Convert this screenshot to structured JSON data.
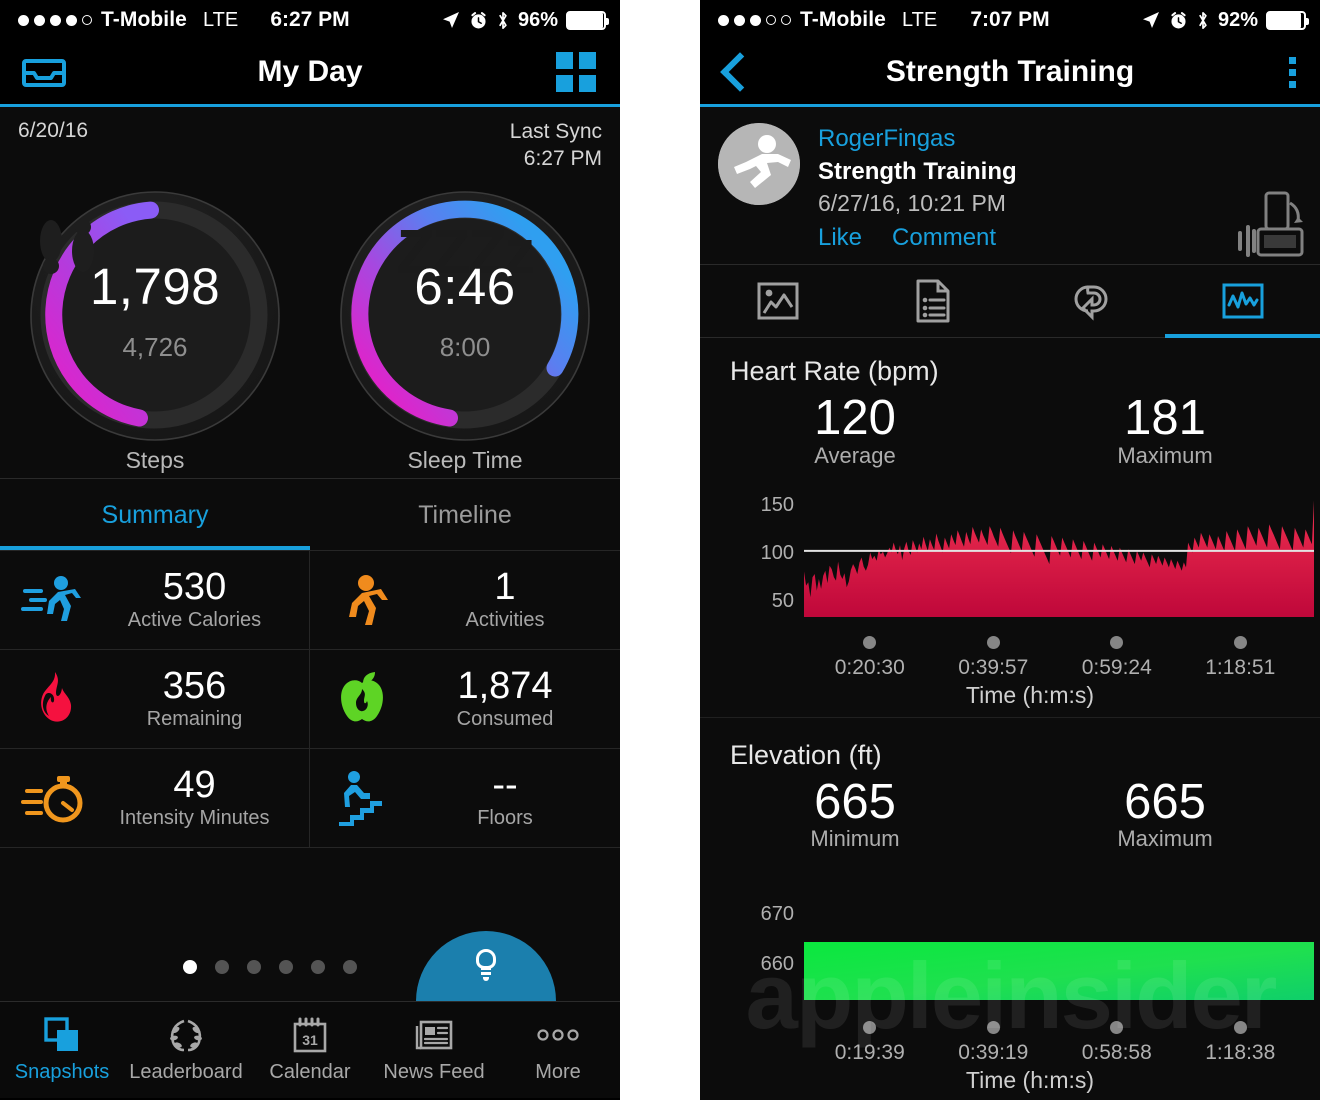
{
  "left_phone": {
    "status_bar": {
      "signal_dots_filled": 4,
      "signal_dots_total": 5,
      "carrier": "T-Mobile",
      "network": "LTE",
      "time": "6:27 PM",
      "battery_percent": "96%",
      "icons": [
        "location-arrow-icon",
        "alarm-clock-icon",
        "bluetooth-icon",
        "battery-icon"
      ]
    },
    "nav": {
      "left_icon": "inbox-icon",
      "title": "My Day",
      "right_icon": "grid-icon",
      "accent": "#18a0dd"
    },
    "header_row": {
      "date": "6/20/16",
      "sync_label": "Last Sync",
      "sync_time": "6:27 PM"
    },
    "gauges": [
      {
        "glyph": "footprints-icon",
        "value": "1,798",
        "goal": "4,726",
        "label": "Steps",
        "progress": 0.38,
        "color_start": "#8b5cf6",
        "color_end": "#e520c8"
      },
      {
        "glyph": "ZZZz",
        "value": "6:46",
        "goal": "8:00",
        "label": "Sleep Time",
        "progress": 0.845,
        "color_start": "#2f9ff0",
        "color_end": "#e520c8"
      }
    ],
    "segments": [
      {
        "label": "Summary",
        "active": true
      },
      {
        "label": "Timeline",
        "active": false
      }
    ],
    "stats": [
      {
        "icon": "running-person-icon",
        "icon_color": "#1f9fe0",
        "value": "530",
        "caption": "Active Calories"
      },
      {
        "icon": "running-person-icon",
        "icon_color": "#f08b1d",
        "value": "1",
        "caption": "Activities"
      },
      {
        "icon": "flame-icon",
        "icon_color": "#f5113f",
        "value": "356",
        "caption": "Remaining"
      },
      {
        "icon": "apple-icon",
        "icon_color": "#5ed425",
        "value": "1,874",
        "caption": "Consumed"
      },
      {
        "icon": "stopwatch-icon",
        "icon_color": "#f0961d",
        "value": "49",
        "caption": "Intensity Minutes"
      },
      {
        "icon": "stairs-person-icon",
        "icon_color": "#1f9fe0",
        "value": "--",
        "caption": "Floors"
      }
    ],
    "pager": {
      "total": 6,
      "active_index": 0
    },
    "fab": {
      "icon": "lightbulb-icon",
      "color": "#1b7fad"
    },
    "tabbar": [
      {
        "icon": "snapshots-icon",
        "label": "Snapshots",
        "active": true
      },
      {
        "icon": "laurel-wreath-icon",
        "label": "Leaderboard",
        "active": false
      },
      {
        "icon": "calendar-icon",
        "label": "Calendar",
        "calendar_day": "31",
        "active": false
      },
      {
        "icon": "newspaper-icon",
        "label": "News Feed",
        "active": false
      },
      {
        "icon": "ellipsis-icon",
        "label": "More",
        "active": false
      }
    ]
  },
  "right_phone": {
    "status_bar": {
      "signal_dots_filled": 3,
      "signal_dots_total": 5,
      "carrier": "T-Mobile",
      "network": "LTE",
      "time": "7:07 PM",
      "battery_percent": "92%",
      "icons": [
        "location-arrow-icon",
        "alarm-clock-icon",
        "bluetooth-icon",
        "battery-icon"
      ]
    },
    "nav": {
      "back_icon": "back-chevron-icon",
      "title": "Strength Training",
      "right_icon": "kebab-menu-icon",
      "accent": "#18a0dd"
    },
    "feed": {
      "avatar_icon": "runner-avatar-icon",
      "username": "RogerFingas",
      "activity_title": "Strength Training",
      "timestamp": "6/27/16, 10:21 PM",
      "like_label": "Like",
      "comment_label": "Comment",
      "rotate_hint_icon": "rotate-device-icon"
    },
    "activity_tabs": [
      {
        "icon": "map-icon",
        "active": false
      },
      {
        "icon": "details-list-icon",
        "active": false
      },
      {
        "icon": "laps-loop-icon",
        "active": false
      },
      {
        "icon": "charts-pulse-icon",
        "active": true
      }
    ],
    "sections": [
      {
        "title": "Heart Rate (bpm)",
        "stats": [
          {
            "value": "120",
            "caption": "Average"
          },
          {
            "value": "181",
            "caption": "Maximum"
          }
        ]
      },
      {
        "title": "Elevation (ft)",
        "stats": [
          {
            "value": "665",
            "caption": "Minimum"
          },
          {
            "value": "665",
            "caption": "Maximum"
          }
        ]
      }
    ],
    "watermark": "appleinsider"
  },
  "chart_data": [
    {
      "type": "area",
      "title": "Heart Rate (bpm)",
      "xlabel": "Time (h:m:s)",
      "ylabel": "bpm",
      "ytick_labels": [
        "150",
        "100",
        "50"
      ],
      "ylim": [
        40,
        190
      ],
      "xtick_labels": [
        "0:20:30",
        "0:39:57",
        "0:59:24",
        "1:18:51"
      ],
      "grid": false,
      "legend": "none",
      "average_line": 120,
      "color_top": "#ef3050",
      "color_bottom": "#c3083a",
      "summary": {
        "average": 120,
        "maximum": 181
      },
      "values": [
        95,
        78,
        82,
        64,
        88,
        92,
        72,
        86,
        74,
        90,
        96,
        81,
        102,
        98,
        88,
        84,
        107,
        91,
        86,
        93,
        76,
        83,
        97,
        104,
        99,
        92,
        106,
        112,
        101,
        96,
        103,
        118,
        110,
        114,
        108,
        121,
        116,
        119,
        112,
        117,
        124,
        118,
        130,
        121,
        116,
        127,
        109,
        123,
        131,
        120,
        115,
        133,
        126,
        118,
        129,
        122,
        137,
        128,
        120,
        134,
        127,
        121,
        141,
        132,
        125,
        118,
        136,
        129,
        123,
        140,
        133,
        127,
        145,
        138,
        131,
        125,
        143,
        135,
        128,
        149,
        142,
        136,
        130,
        146,
        139,
        133,
        127,
        150,
        144,
        137,
        131,
        125,
        148,
        141,
        135,
        129,
        123,
        117,
        145,
        138,
        132,
        126,
        120,
        143,
        137,
        131,
        125,
        119,
        113,
        140,
        134,
        128,
        122,
        116,
        110,
        104,
        138,
        132,
        126,
        120,
        114,
        136,
        130,
        124,
        118,
        112,
        134,
        128,
        122,
        116,
        110,
        132,
        126,
        120,
        114,
        108,
        130,
        124,
        118,
        112,
        128,
        122,
        116,
        110,
        126,
        120,
        114,
        108,
        124,
        118,
        112,
        106,
        122,
        116,
        110,
        104,
        120,
        114,
        108,
        118,
        112,
        106,
        100,
        116,
        110,
        104,
        114,
        108,
        102,
        112,
        106,
        100,
        110,
        104,
        98,
        108,
        102,
        96,
        106,
        100,
        130,
        124,
        118,
        136,
        130,
        124,
        142,
        136,
        130,
        124,
        140,
        134,
        128,
        122,
        138,
        132,
        126,
        120,
        144,
        138,
        132,
        126,
        120,
        146,
        140,
        134,
        128,
        122,
        150,
        144,
        138,
        132,
        126,
        148,
        142,
        136,
        130,
        124,
        152,
        146,
        140,
        134,
        128,
        122,
        150,
        144,
        138,
        132,
        126,
        120,
        148,
        142,
        136,
        130,
        124,
        146,
        140,
        134,
        128,
        181
      ]
    },
    {
      "type": "area",
      "title": "Elevation (ft)",
      "xlabel": "Time (h:m:s)",
      "ylabel": "ft",
      "ytick_labels": [
        "670",
        "660"
      ],
      "ylim": [
        652,
        674
      ],
      "xtick_labels": [
        "0:19:39",
        "0:39:19",
        "0:58:58",
        "1:18:38"
      ],
      "grid": false,
      "legend": "none",
      "constant_value": 665,
      "color_top": "#0ae83e",
      "color_bottom": "#11c96a",
      "summary": {
        "minimum": 665,
        "maximum": 665
      }
    }
  ]
}
